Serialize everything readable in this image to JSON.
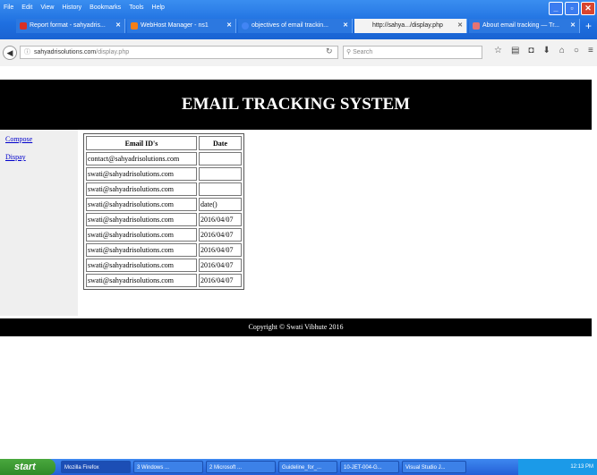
{
  "browser": {
    "menu": [
      "File",
      "Edit",
      "View",
      "History",
      "Bookmarks",
      "Tools",
      "Help"
    ],
    "tabs": [
      {
        "label": "Report format - sahyadris...",
        "icon": "gmail-icon",
        "color": "#d93025"
      },
      {
        "label": "WebHost Manager - ns1",
        "icon": "cpanel-icon",
        "color": "#f57f17"
      },
      {
        "label": "objectives of email trackin...",
        "icon": "google-icon",
        "color": "#4285f4"
      },
      {
        "label": "http://sahya.../display.php",
        "icon": "page-icon",
        "color": "#999999"
      },
      {
        "label": "About email tracking — Tr...",
        "icon": "shield-icon",
        "color": "#e57373"
      }
    ],
    "url_domain": "sahyadrisolutions.com",
    "url_path": "/display.php",
    "search_placeholder": "Search"
  },
  "page": {
    "title": "EMAIL TRACKING SYSTEM",
    "nav": {
      "compose": "Compose",
      "display": "Dispay"
    },
    "table": {
      "headers": [
        "Email ID's",
        "Date"
      ],
      "rows": [
        {
          "email": "contact@sahyadrisolutions.com",
          "date": ""
        },
        {
          "email": "swati@sahyadrisolutions.com",
          "date": ""
        },
        {
          "email": "swati@sahyadrisolutions.com",
          "date": ""
        },
        {
          "email": "swati@sahyadrisolutions.com",
          "date": "date()"
        },
        {
          "email": "swati@sahyadrisolutions.com",
          "date": "2016/04/07"
        },
        {
          "email": "swati@sahyadrisolutions.com",
          "date": "2016/04/07"
        },
        {
          "email": "swati@sahyadrisolutions.com",
          "date": "2016/04/07"
        },
        {
          "email": "swati@sahyadrisolutions.com",
          "date": "2016/04/07"
        },
        {
          "email": "swati@sahyadrisolutions.com",
          "date": "2016/04/07"
        }
      ]
    },
    "footer": "Copyright © Swati Vibhute 2016"
  },
  "taskbar": {
    "start": "start",
    "tasks": [
      "Mozilla Firefox",
      "3 Windows ...",
      "2 Microsoft ...",
      "Guideline_for_...",
      "10-JET-004-G...",
      "Visual Studio J..."
    ],
    "time": "12:13 PM"
  }
}
